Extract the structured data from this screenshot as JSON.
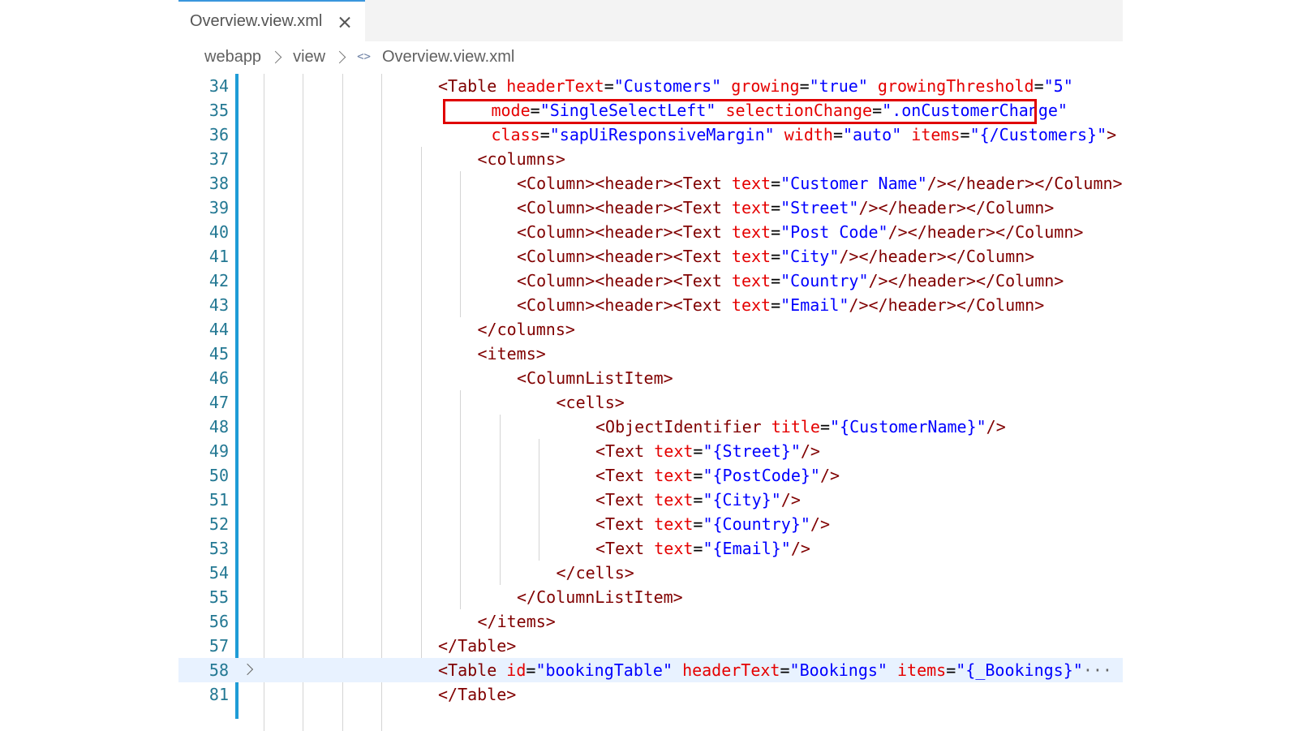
{
  "tab": {
    "label": "Overview.view.xml"
  },
  "breadcrumb": {
    "parts": [
      "webapp",
      "view",
      "Overview.view.xml"
    ],
    "file_icon": "<>"
  },
  "lines": [
    {
      "n": "34",
      "indent": 4,
      "tokens": [
        [
          "tag",
          "<Table "
        ],
        [
          "attr",
          "headerText"
        ],
        [
          "op",
          "="
        ],
        [
          "str",
          "\"Customers\""
        ],
        [
          "op",
          " "
        ],
        [
          "attr",
          "growing"
        ],
        [
          "op",
          "="
        ],
        [
          "str",
          "\"true\""
        ],
        [
          "op",
          " "
        ],
        [
          "attr",
          "growingThreshold"
        ],
        [
          "op",
          "="
        ],
        [
          "str",
          "\"5\""
        ]
      ]
    },
    {
      "n": "35",
      "indent": 6.7,
      "tokens": [
        [
          "attr",
          "mode"
        ],
        [
          "op",
          "="
        ],
        [
          "str",
          "\"SingleSelectLeft\""
        ],
        [
          "op",
          " "
        ],
        [
          "attr",
          "selectionChange"
        ],
        [
          "op",
          "="
        ],
        [
          "str",
          "\".onCustomerChange\""
        ]
      ]
    },
    {
      "n": "36",
      "indent": 6.7,
      "tokens": [
        [
          "attr",
          "class"
        ],
        [
          "op",
          "="
        ],
        [
          "str",
          "\"sapUiResponsiveMargin\""
        ],
        [
          "op",
          " "
        ],
        [
          "attr",
          "width"
        ],
        [
          "op",
          "="
        ],
        [
          "str",
          "\"auto\""
        ],
        [
          "op",
          " "
        ],
        [
          "attr",
          "items"
        ],
        [
          "op",
          "="
        ],
        [
          "str",
          "\"{/Customers}\""
        ],
        [
          "tag",
          ">"
        ]
      ]
    },
    {
      "n": "37",
      "indent": 6,
      "tokens": [
        [
          "tag",
          "<columns>"
        ]
      ]
    },
    {
      "n": "38",
      "indent": 8,
      "tokens": [
        [
          "tag",
          "<Column><header><Text "
        ],
        [
          "attr",
          "text"
        ],
        [
          "op",
          "="
        ],
        [
          "str",
          "\"Customer Name\""
        ],
        [
          "tag",
          "/></header></Column>"
        ]
      ]
    },
    {
      "n": "39",
      "indent": 8,
      "tokens": [
        [
          "tag",
          "<Column><header><Text "
        ],
        [
          "attr",
          "text"
        ],
        [
          "op",
          "="
        ],
        [
          "str",
          "\"Street\""
        ],
        [
          "tag",
          "/></header></Column>"
        ]
      ]
    },
    {
      "n": "40",
      "indent": 8,
      "tokens": [
        [
          "tag",
          "<Column><header><Text "
        ],
        [
          "attr",
          "text"
        ],
        [
          "op",
          "="
        ],
        [
          "str",
          "\"Post Code\""
        ],
        [
          "tag",
          "/></header></Column>"
        ]
      ]
    },
    {
      "n": "41",
      "indent": 8,
      "tokens": [
        [
          "tag",
          "<Column><header><Text "
        ],
        [
          "attr",
          "text"
        ],
        [
          "op",
          "="
        ],
        [
          "str",
          "\"City\""
        ],
        [
          "tag",
          "/></header></Column>"
        ]
      ]
    },
    {
      "n": "42",
      "indent": 8,
      "tokens": [
        [
          "tag",
          "<Column><header><Text "
        ],
        [
          "attr",
          "text"
        ],
        [
          "op",
          "="
        ],
        [
          "str",
          "\"Country\""
        ],
        [
          "tag",
          "/></header></Column>"
        ]
      ]
    },
    {
      "n": "43",
      "indent": 8,
      "tokens": [
        [
          "tag",
          "<Column><header><Text "
        ],
        [
          "attr",
          "text"
        ],
        [
          "op",
          "="
        ],
        [
          "str",
          "\"Email\""
        ],
        [
          "tag",
          "/></header></Column>"
        ]
      ]
    },
    {
      "n": "44",
      "indent": 6,
      "tokens": [
        [
          "tag",
          "</columns>"
        ]
      ]
    },
    {
      "n": "45",
      "indent": 6,
      "tokens": [
        [
          "tag",
          "<items>"
        ]
      ]
    },
    {
      "n": "46",
      "indent": 8,
      "tokens": [
        [
          "tag",
          "<ColumnListItem>"
        ]
      ]
    },
    {
      "n": "47",
      "indent": 10,
      "tokens": [
        [
          "tag",
          "<cells>"
        ]
      ]
    },
    {
      "n": "48",
      "indent": 12,
      "tokens": [
        [
          "tag",
          "<ObjectIdentifier "
        ],
        [
          "attr",
          "title"
        ],
        [
          "op",
          "="
        ],
        [
          "str",
          "\"{CustomerName}\""
        ],
        [
          "tag",
          "/>"
        ]
      ]
    },
    {
      "n": "49",
      "indent": 12,
      "tokens": [
        [
          "tag",
          "<Text "
        ],
        [
          "attr",
          "text"
        ],
        [
          "op",
          "="
        ],
        [
          "str",
          "\"{Street}\""
        ],
        [
          "tag",
          "/>"
        ]
      ]
    },
    {
      "n": "50",
      "indent": 12,
      "tokens": [
        [
          "tag",
          "<Text "
        ],
        [
          "attr",
          "text"
        ],
        [
          "op",
          "="
        ],
        [
          "str",
          "\"{PostCode}\""
        ],
        [
          "tag",
          "/>"
        ]
      ]
    },
    {
      "n": "51",
      "indent": 12,
      "tokens": [
        [
          "tag",
          "<Text "
        ],
        [
          "attr",
          "text"
        ],
        [
          "op",
          "="
        ],
        [
          "str",
          "\"{City}\""
        ],
        [
          "tag",
          "/>"
        ]
      ]
    },
    {
      "n": "52",
      "indent": 12,
      "tokens": [
        [
          "tag",
          "<Text "
        ],
        [
          "attr",
          "text"
        ],
        [
          "op",
          "="
        ],
        [
          "str",
          "\"{Country}\""
        ],
        [
          "tag",
          "/>"
        ]
      ]
    },
    {
      "n": "53",
      "indent": 12,
      "tokens": [
        [
          "tag",
          "<Text "
        ],
        [
          "attr",
          "text"
        ],
        [
          "op",
          "="
        ],
        [
          "str",
          "\"{Email}\""
        ],
        [
          "tag",
          "/>"
        ]
      ]
    },
    {
      "n": "54",
      "indent": 10,
      "tokens": [
        [
          "tag",
          "</cells>"
        ]
      ]
    },
    {
      "n": "55",
      "indent": 8,
      "tokens": [
        [
          "tag",
          "</ColumnListItem>"
        ]
      ]
    },
    {
      "n": "56",
      "indent": 6,
      "tokens": [
        [
          "tag",
          "</items>"
        ]
      ]
    },
    {
      "n": "57",
      "indent": 4,
      "tokens": [
        [
          "tag",
          "</Table>"
        ]
      ]
    },
    {
      "n": "58",
      "indent": 4,
      "folded": true,
      "current": true,
      "tokens": [
        [
          "tag",
          "<Table "
        ],
        [
          "attr",
          "id"
        ],
        [
          "op",
          "="
        ],
        [
          "str",
          "\"bookingTable\""
        ],
        [
          "op",
          " "
        ],
        [
          "attr",
          "headerText"
        ],
        [
          "op",
          "="
        ],
        [
          "str",
          "\"Bookings\""
        ],
        [
          "op",
          " "
        ],
        [
          "attr",
          "items"
        ],
        [
          "op",
          "="
        ],
        [
          "str",
          "\"{_Bookings}\""
        ],
        [
          "ellipsis",
          "···"
        ]
      ]
    },
    {
      "n": "81",
      "indent": 4,
      "tokens": [
        [
          "tag",
          "</Table>"
        ]
      ]
    }
  ],
  "colors": {
    "tag": "#800000",
    "attribute": "#e50000",
    "string": "#0000ff",
    "line_number": "#237893",
    "highlight_box": "#e00000",
    "current_line": "#e8f2ff",
    "gutter_bar": "#1f9cd6"
  },
  "icons": {
    "tab_close": "close-icon",
    "breadcrumb_separator": "chevron-right-icon",
    "file_type": "xml-code-icon",
    "fold": "chevron-right-icon"
  }
}
